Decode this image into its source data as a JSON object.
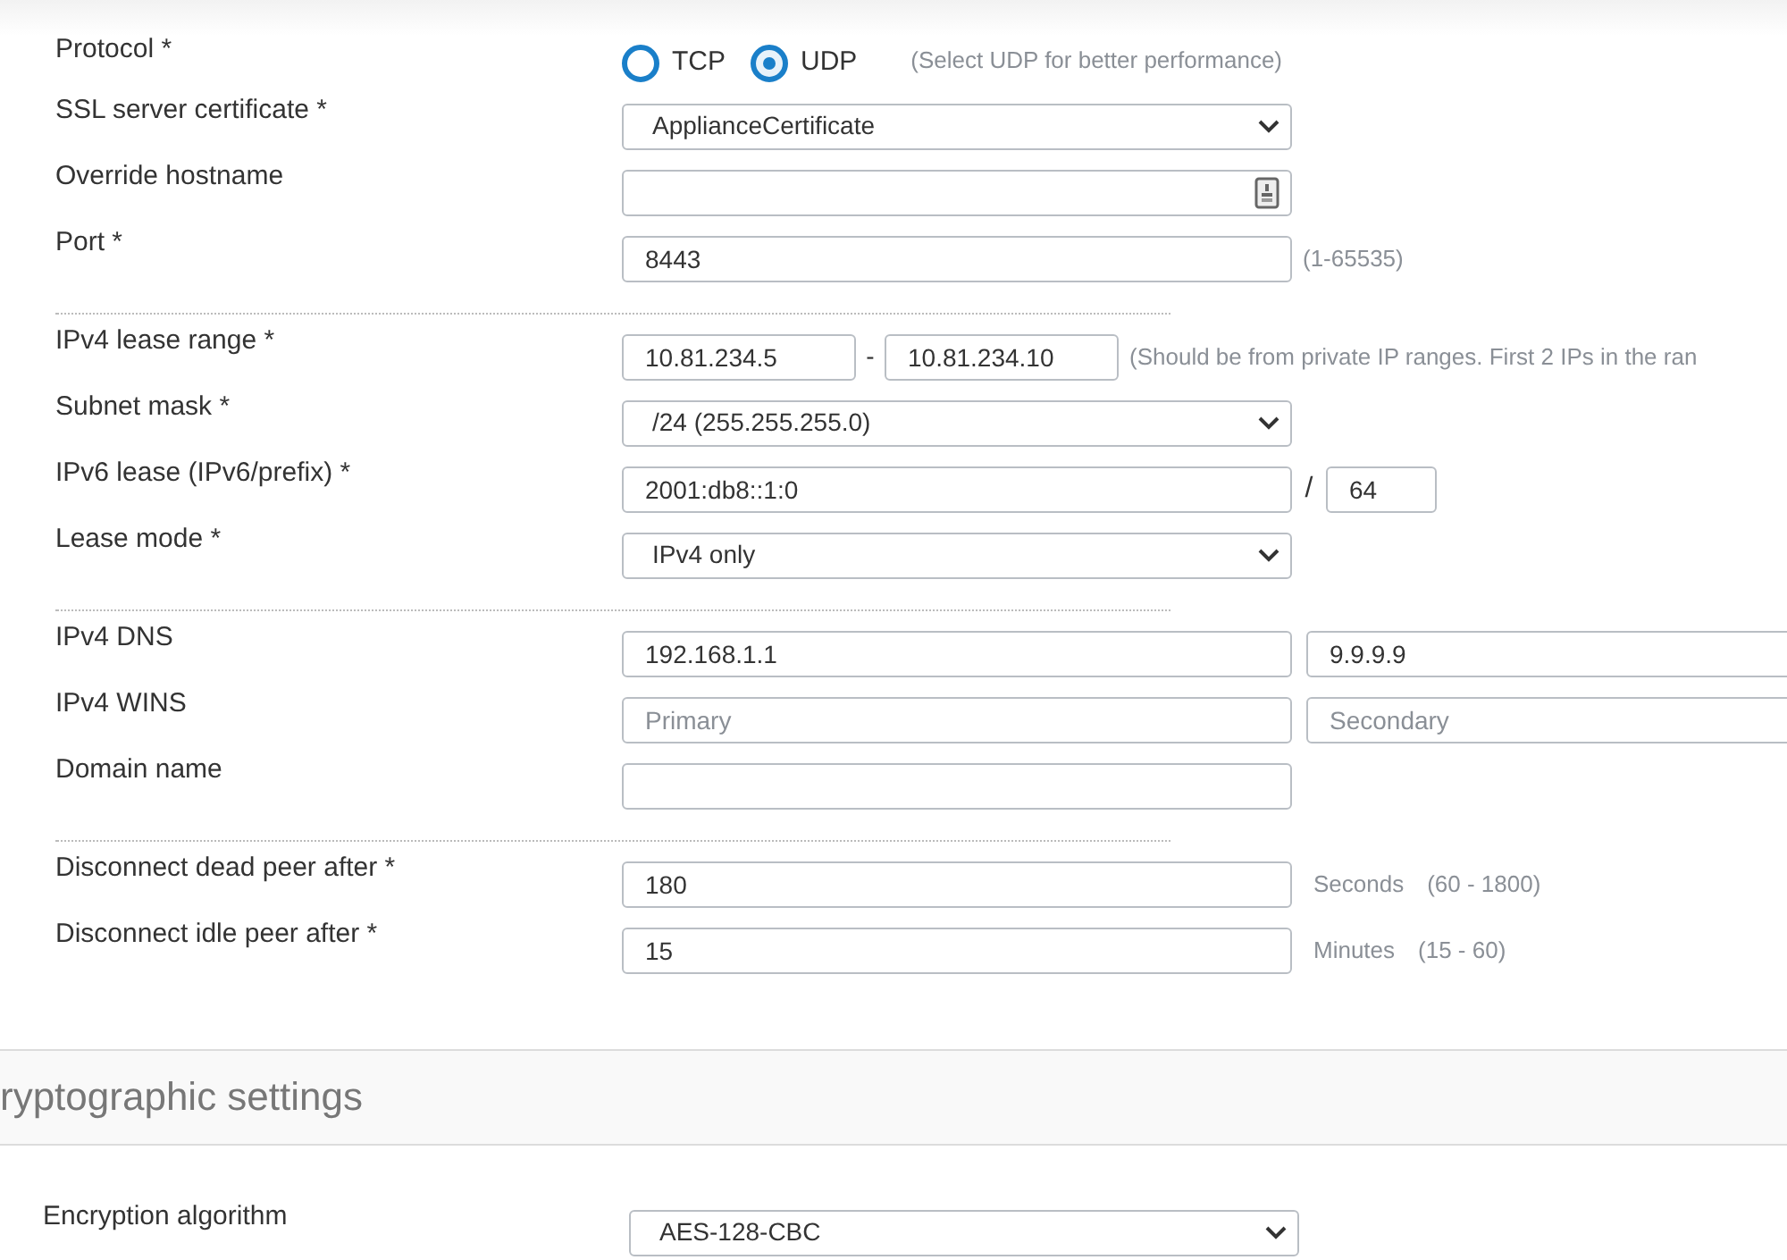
{
  "groups": [
    [
      {
        "kind": "radio",
        "label": "Protocol *",
        "options": [
          {
            "label": "TCP",
            "selected": false
          },
          {
            "label": "UDP",
            "selected": true
          }
        ],
        "hint": "(Select UDP for better performance)"
      },
      {
        "kind": "select",
        "label": "SSL server certificate *",
        "value": "ApplianceCertificate"
      },
      {
        "kind": "input",
        "label": "Override hostname",
        "picker": true
      },
      {
        "kind": "input",
        "label": "Port *",
        "value": "8443",
        "hint": "(1-65535)"
      }
    ],
    [
      {
        "kind": "range",
        "label": "IPv4 lease range *",
        "from": "10.81.234.5",
        "separator": "-",
        "to": "10.81.234.10",
        "hint": "(Should be from private IP ranges. First 2 IPs in the ran"
      },
      {
        "kind": "select",
        "label": "Subnet mask *",
        "value": "/24 (255.255.255.0)"
      },
      {
        "kind": "prefix",
        "label": "IPv6 lease (IPv6/prefix) *",
        "value": "2001:db8::1:0",
        "separator": "/",
        "prefix": "64"
      },
      {
        "kind": "select",
        "label": "Lease mode *",
        "value": "IPv4 only"
      }
    ],
    [
      {
        "kind": "pair",
        "label": "IPv4 DNS",
        "fields": [
          {
            "value": "192.168.1.1"
          },
          {
            "value": "9.9.9.9"
          }
        ]
      },
      {
        "kind": "pair",
        "label": "IPv4 WINS",
        "fields": [
          {
            "placeholder": "Primary"
          },
          {
            "placeholder": "Secondary"
          }
        ]
      },
      {
        "kind": "input",
        "label": "Domain name"
      }
    ],
    [
      {
        "kind": "input",
        "label": "Disconnect dead peer after *",
        "value": "180",
        "unit": "Seconds",
        "hint": "(60 - 1800)"
      },
      {
        "kind": "input",
        "label": "Disconnect idle peer after *",
        "value": "15",
        "unit": "Minutes",
        "hint": "(15 - 60)"
      }
    ]
  ],
  "section": {
    "title": "ryptographic settings"
  },
  "crypto_rows": [
    {
      "kind": "select",
      "label": "Encryption algorithm",
      "value": "AES-128-CBC"
    }
  ]
}
